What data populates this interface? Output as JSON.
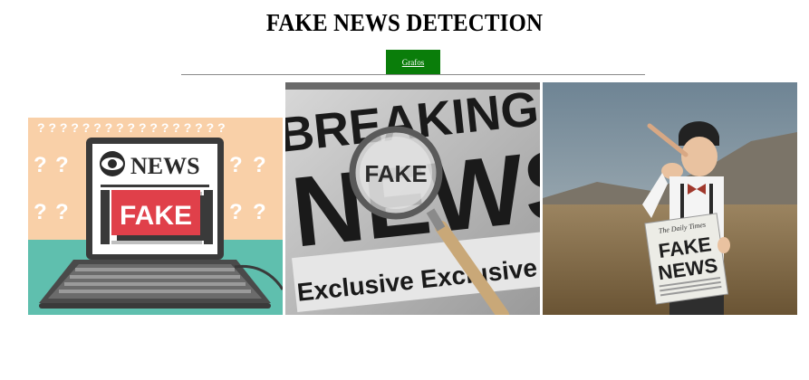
{
  "header": {
    "title": "FAKE NEWS DETECTION",
    "nav_button_label": "Grafos"
  },
  "gallery": {
    "images": [
      {
        "name": "fake-news-laptop-illustration",
        "text_news": "NEWS",
        "text_fake": "FAKE"
      },
      {
        "name": "breaking-news-magnifier-photo",
        "text_breaking": "BREAKING",
        "text_news": "NEWS",
        "text_fake": "FAKE",
        "text_exclusive": "Exclusive Exclusive Exclusive"
      },
      {
        "name": "boy-pinocchio-newspaper-photo",
        "text_paper_header": "The Daily Times",
        "text_fake": "FAKE",
        "text_news": "NEWS"
      }
    ]
  },
  "colors": {
    "button_bg": "#0a7d0a",
    "peach": "#f9d0a8",
    "teal": "#5fbfae",
    "fake_red": "#e0404a"
  }
}
